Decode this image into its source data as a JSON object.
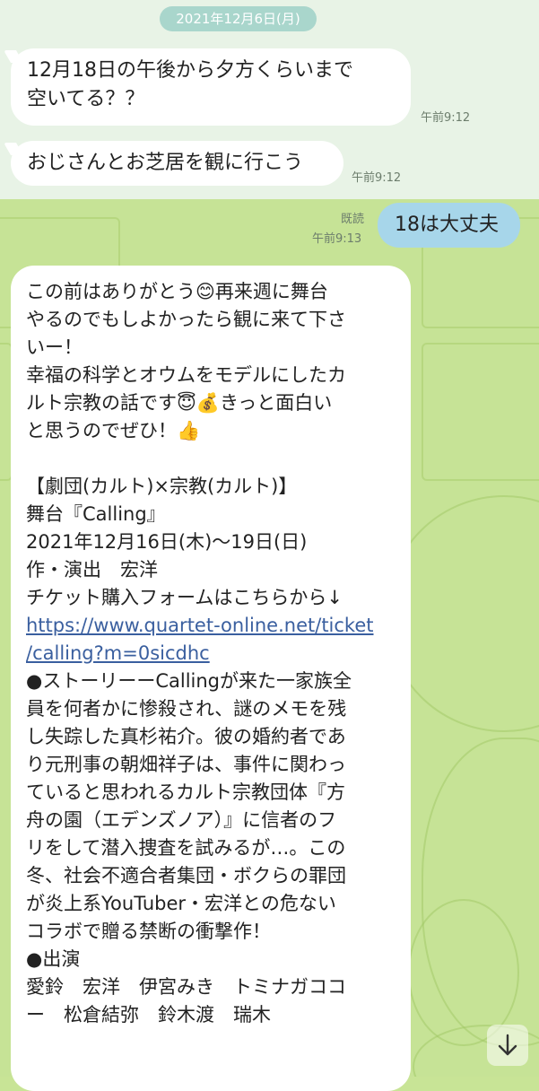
{
  "date_chip": "2021年12月6日(月)",
  "messages": {
    "m1": {
      "text": "12月18日の午後から夕方くらいまで\n空いてる？？",
      "time": "午前9:12"
    },
    "m2": {
      "text": "おじさんとお芝居を観に行こう",
      "time": "午前9:12"
    },
    "m3": {
      "text": "18は大丈夫",
      "read": "既読",
      "time": "午前9:13"
    }
  },
  "long_message": {
    "lines": [
      "この前はありがとう😊再来週に舞台",
      "やるのでもしよかったら観に来て下さ",
      "いー！",
      "幸福の科学とオウムをモデルにしたカ",
      "ルト宗教の話です😇💰きっと面白い",
      "と思うのでぜひ！👍",
      "",
      "【劇団(カルト)×宗教(カルト)】",
      "舞台『Calling』",
      "2021年12月16日(木)〜19日(日)",
      "作・演出　宏洋",
      "チケット購入フォームはこちらから↓",
      "https://www.quartet-online.net/ticket",
      "/calling?m=0sicdhc",
      "●ストーリーーCallingが来た一家族全",
      "員を何者かに惨殺され、謎のメモを残",
      "し失踪した真杉祐介。彼の婚約者であ",
      "り元刑事の朝畑祥子は、事件に関わっ",
      "ていると思われるカルト宗教団体『方",
      "舟の園（エデンズノア）』に信者のフ",
      "リをして潜入捜査を試みるが…。この",
      "冬、社会不適合者集団・ボクらの罪団",
      "が炎上系YouTuber・宏洋との危ない",
      "コラボで贈る禁断の衝撃作！",
      "●出演",
      "愛鈴　宏洋　伊宮みき　トミナガココ",
      "ー　松倉結弥　鈴木渡　瑞木"
    ]
  },
  "icons": {
    "scroll_down": "arrow-down-icon"
  }
}
